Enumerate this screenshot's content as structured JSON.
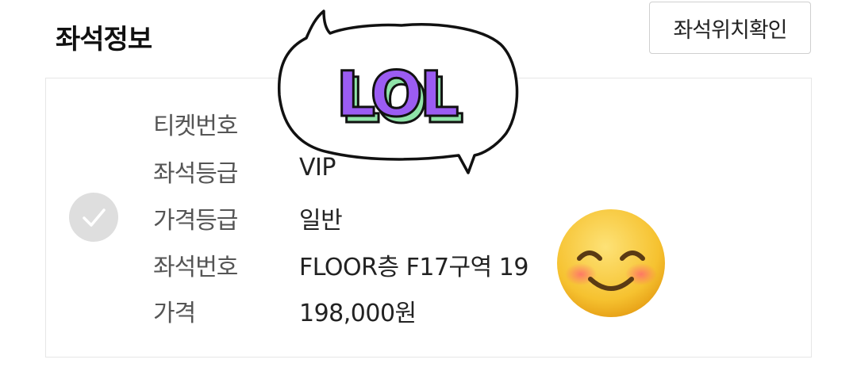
{
  "header": {
    "title": "좌석정보",
    "seat_location_button": "좌석위치확인"
  },
  "details": {
    "rows": [
      {
        "label": "티켓번호",
        "value": ""
      },
      {
        "label": "좌석등급",
        "value": "VIP"
      },
      {
        "label": "가격등급",
        "value": "일반"
      },
      {
        "label": "좌석번호",
        "value": "FLOOR층 F17구역 19"
      },
      {
        "label": "가격",
        "value": "198,000원"
      }
    ]
  },
  "stickers": {
    "speech_bubble_text": "LOL",
    "emoji": "smiling-face-with-smiling-eyes-icon"
  },
  "colors": {
    "lol_fill": "#9b5cf2",
    "lol_side": "#8fe3a8",
    "check_bg": "#dedede",
    "emoji_yellow": "#f7c531"
  }
}
